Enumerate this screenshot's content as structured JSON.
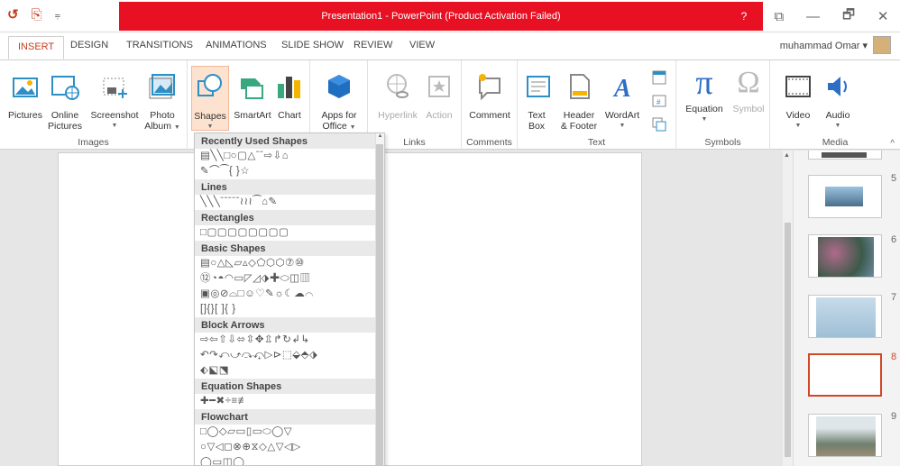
{
  "window": {
    "title": "Presentation1 - PowerPoint (Product Activation Failed)",
    "help": "?",
    "restore_label": "⧉",
    "minimize_label": "—",
    "maximize_label": "🗗",
    "close_label": "✕"
  },
  "qat": {
    "undo": "↺",
    "screen": "⎘",
    "custom": "⩦"
  },
  "tabs": [
    "INSERT",
    "DESIGN",
    "TRANSITIONS",
    "ANIMATIONS",
    "SLIDE SHOW",
    "REVIEW",
    "VIEW"
  ],
  "active_tab": "INSERT",
  "user": {
    "name": "muhammad Omar",
    "chevron": "▾"
  },
  "ribbon": {
    "groups": {
      "images": "Images",
      "links": "Links",
      "comments": "Comments",
      "text": "Text",
      "symbols": "Symbols",
      "media": "Media"
    },
    "buttons": {
      "pictures": "Pictures",
      "online_pictures_1": "Online",
      "online_pictures_2": "Pictures",
      "screenshot": "Screenshot",
      "photo_album_1": "Photo",
      "photo_album_2": "Album",
      "shapes": "Shapes",
      "smartart": "SmartArt",
      "chart": "Chart",
      "apps_1": "Apps for",
      "apps_2": "Office",
      "hyperlink": "Hyperlink",
      "action": "Action",
      "comment": "Comment",
      "textbox_1": "Text",
      "textbox_2": "Box",
      "header_1": "Header",
      "header_2": "& Footer",
      "wordart": "WordArt",
      "equation": "Equation",
      "symbol": "Symbol",
      "video": "Video",
      "audio": "Audio"
    },
    "collapse": "^"
  },
  "shapes_gallery": {
    "sections": [
      {
        "title": "Recently Used Shapes",
        "rows": [
          "▤╲╲□○▢△ˉˉ⇨⇩⌂",
          "✎⌒⁀{ }☆"
        ]
      },
      {
        "title": "Lines",
        "rows": [
          "╲╲╲ˉˉˉˉˉ≀≀≀⁀⌂✎"
        ]
      },
      {
        "title": "Rectangles",
        "rows": [
          "□▢▢▢▢▢▢▢▢"
        ]
      },
      {
        "title": "Basic Shapes",
        "rows": [
          "▤○△◺▱▵◇⬠⬡⬡⑦⑩",
          "⑫◔◓◠▭◸◿⬗✚⬭◫▥",
          "▣◎⊘⌓□☺♡✎☼☾☁⌒",
          "[]{}[ ]{ }"
        ]
      },
      {
        "title": "Block Arrows",
        "rows": [
          "⇨⇦⇧⇩⬄⇳✥⇫↱↻↲↳",
          "↶↷⤺⤻⤼⤽▷⊳⬚⬙⬘⬗",
          "⬖⬕⬔"
        ]
      },
      {
        "title": "Equation Shapes",
        "rows": [
          "✚━✖÷≡≢"
        ]
      },
      {
        "title": "Flowchart",
        "rows": [
          "□◯◇▱▭▯▭⬭◯▽",
          "○▽◁◻⊗⊕⧖◇△▽◁▷",
          "◯▭◫◯"
        ]
      }
    ]
  },
  "thumbnails": [
    {
      "number": "5"
    },
    {
      "number": "6"
    },
    {
      "number": "7"
    },
    {
      "number": "8"
    },
    {
      "number": "9"
    }
  ],
  "colors": {
    "accent": "#c43e1c",
    "titlebar_red": "#e81123",
    "selected": "#fde2cf"
  }
}
